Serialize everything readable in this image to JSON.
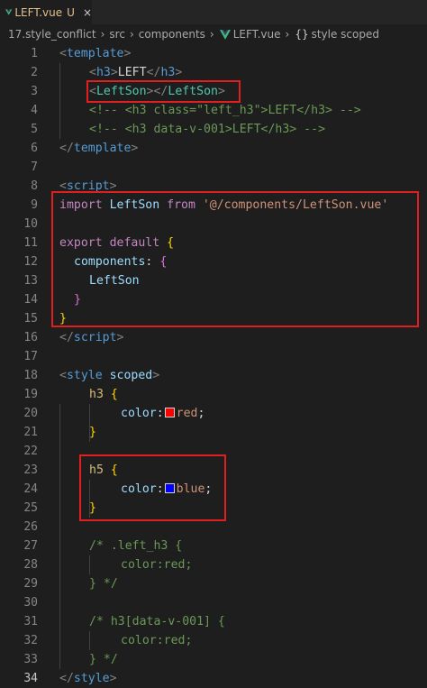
{
  "tab": {
    "filename": "LEFT.vue",
    "badge": "U",
    "close": "×"
  },
  "breadcrumb": {
    "items": [
      "17.style_conflict",
      "src",
      "components",
      "LEFT.vue",
      "style scoped"
    ],
    "separator": "›"
  },
  "gutter": {
    "numbers": [
      "1",
      "2",
      "3",
      "4",
      "5",
      "6",
      "7",
      "8",
      "9",
      "10",
      "11",
      "12",
      "13",
      "14",
      "15",
      "16",
      "17",
      "18",
      "19",
      "20",
      "21",
      "22",
      "23",
      "24",
      "25",
      "26",
      "27",
      "28",
      "29",
      "30",
      "31",
      "32",
      "33",
      "34"
    ],
    "active_line": "34"
  },
  "code": {
    "l1": {
      "lt": "<",
      "tag": "template",
      "gt": ">"
    },
    "l2": {
      "open_lt": "<",
      "tag": "h3",
      "open_gt": ">",
      "text": "LEFT",
      "close_lt": "</",
      "close_tag": "h3",
      "close_gt": ">"
    },
    "l3": {
      "open_lt": "<",
      "tag": "LeftSon",
      "open_gt": ">",
      "close_lt": "</",
      "close_tag": "LeftSon",
      "close_gt": ">"
    },
    "l4": {
      "comment": "<!-- <h3 class=\"left_h3\">LEFT</h3> -->"
    },
    "l5": {
      "comment": "<!-- <h3 data-v-001>LEFT</h3> -->"
    },
    "l6": {
      "lt": "</",
      "tag": "template",
      "gt": ">"
    },
    "l8": {
      "lt": "<",
      "tag": "script",
      "gt": ">"
    },
    "l9": {
      "kw1": "import",
      "name": "LeftSon",
      "kw2": "from",
      "str": "'@/components/LeftSon.vue'"
    },
    "l11": {
      "kw1": "export",
      "kw2": "default",
      "brace": "{"
    },
    "l12": {
      "prop": "components",
      "colon": ":",
      "brace": "{"
    },
    "l13": {
      "name": "LeftSon"
    },
    "l14": {
      "brace": "}"
    },
    "l15": {
      "brace": "}"
    },
    "l16": {
      "lt": "</",
      "tag": "script",
      "gt": ">"
    },
    "l18": {
      "lt": "<",
      "tag": "style",
      "attr": "scoped",
      "gt": ">"
    },
    "l19": {
      "sel": "h3",
      "brace": "{"
    },
    "l20": {
      "prop": "color",
      "colon": ":",
      "value": "red",
      "semi": ";"
    },
    "l21": {
      "brace": "}"
    },
    "l23": {
      "sel": "h5",
      "brace": "{"
    },
    "l24": {
      "prop": "color",
      "colon": ":",
      "value": "blue",
      "semi": ";"
    },
    "l25": {
      "brace": "}"
    },
    "l27": {
      "comment": "/* .left_h3 {"
    },
    "l28": {
      "comment": "color:red;"
    },
    "l29": {
      "comment": "} */"
    },
    "l31": {
      "comment": "/* h3[data-v-001] {"
    },
    "l32": {
      "comment": "color:red;"
    },
    "l33": {
      "comment": "} */"
    },
    "l34": {
      "lt": "</",
      "tag": "style",
      "gt": ">"
    }
  },
  "colors": {
    "background": "#1e1e1e",
    "annotation_red": "#e02020",
    "swatch_red": "#ff0000",
    "swatch_blue": "#0000ff"
  }
}
